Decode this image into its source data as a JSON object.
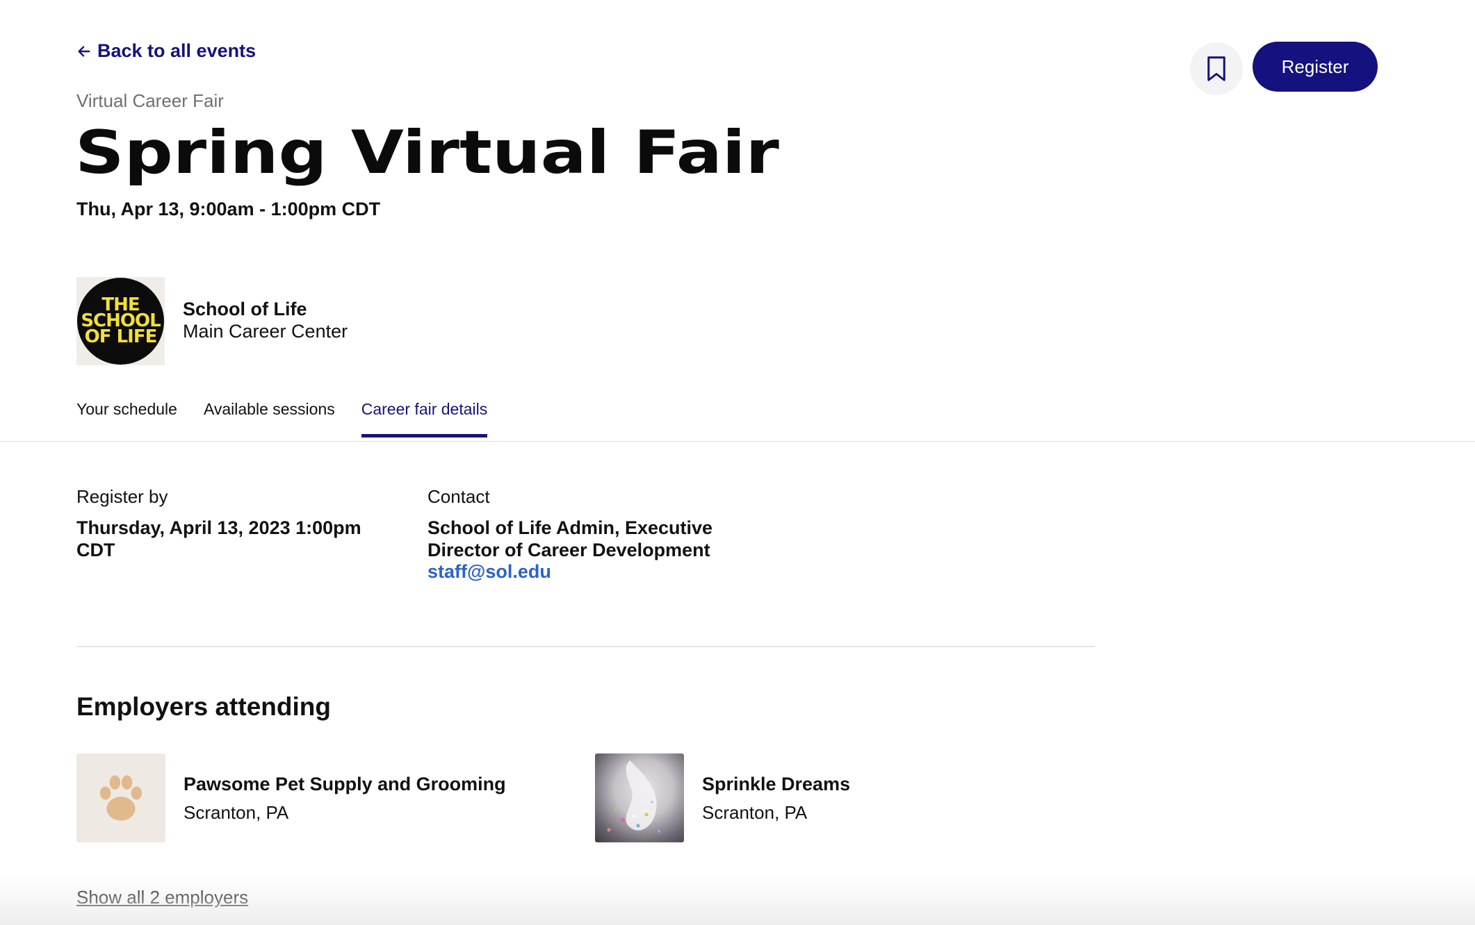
{
  "nav": {
    "back_label": "Back to all events"
  },
  "actions": {
    "register_label": "Register"
  },
  "event": {
    "type": "Virtual Career Fair",
    "title": "Spring Virtual Fair",
    "date": "Thu, Apr 13, 9:00am - 1:00pm CDT"
  },
  "organizer": {
    "logo_lines": [
      "THE",
      "SCHOOL",
      "OF LIFE"
    ],
    "name": "School of Life",
    "department": "Main Career Center"
  },
  "tabs": [
    {
      "label": "Your schedule",
      "active": false
    },
    {
      "label": "Available sessions",
      "active": false
    },
    {
      "label": "Career fair details",
      "active": true
    }
  ],
  "details": {
    "register_by_label": "Register by",
    "register_by_value": "Thursday, April 13, 2023 1:00pm CDT",
    "contact_label": "Contact",
    "contact_name": "School of Life Admin, Executive Director of Career Development",
    "contact_email": "staff@sol.edu"
  },
  "employers": {
    "heading": "Employers attending",
    "items": [
      {
        "name": "Pawsome Pet Supply and Grooming",
        "location": "Scranton, PA",
        "icon": "paw-icon"
      },
      {
        "name": "Sprinkle Dreams",
        "location": "Scranton, PA",
        "icon": "sprinkle-photo"
      }
    ],
    "show_all_label": "Show all 2 employers"
  },
  "colors": {
    "brand": "#15117e",
    "link": "#2b63c8",
    "logo_yellow": "#f2df3a"
  }
}
